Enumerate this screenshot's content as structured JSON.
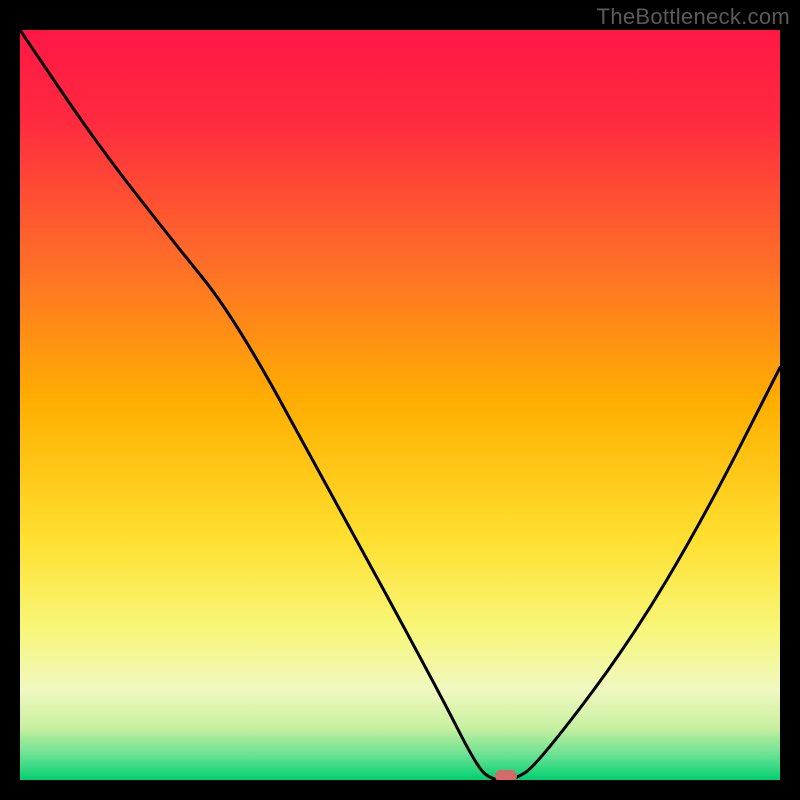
{
  "watermark": "TheBottleneck.com",
  "chart_data": {
    "type": "line",
    "title": "",
    "xlabel": "",
    "ylabel": "",
    "xlim": [
      0,
      100
    ],
    "ylim": [
      0,
      100
    ],
    "series": [
      {
        "name": "bottleneck-curve",
        "x": [
          0,
          10,
          20,
          28,
          40,
          55,
          60,
          62,
          65,
          68,
          80,
          90,
          100
        ],
        "y": [
          100,
          85,
          72,
          62,
          40,
          12,
          2,
          0,
          0,
          2,
          18,
          35,
          55
        ]
      }
    ],
    "marker": {
      "x": 64,
      "y": 0
    },
    "gradient_stops": [
      {
        "offset": 0.0,
        "color": "#ff1744"
      },
      {
        "offset": 0.12,
        "color": "#ff2a3f"
      },
      {
        "offset": 0.3,
        "color": "#ff6a2a"
      },
      {
        "offset": 0.5,
        "color": "#ffb000"
      },
      {
        "offset": 0.68,
        "color": "#ffe030"
      },
      {
        "offset": 0.8,
        "color": "#f7f77a"
      },
      {
        "offset": 0.88,
        "color": "#f0f8c0"
      },
      {
        "offset": 0.93,
        "color": "#c8f0a0"
      },
      {
        "offset": 0.97,
        "color": "#60e090"
      },
      {
        "offset": 1.0,
        "color": "#00d070"
      }
    ]
  }
}
